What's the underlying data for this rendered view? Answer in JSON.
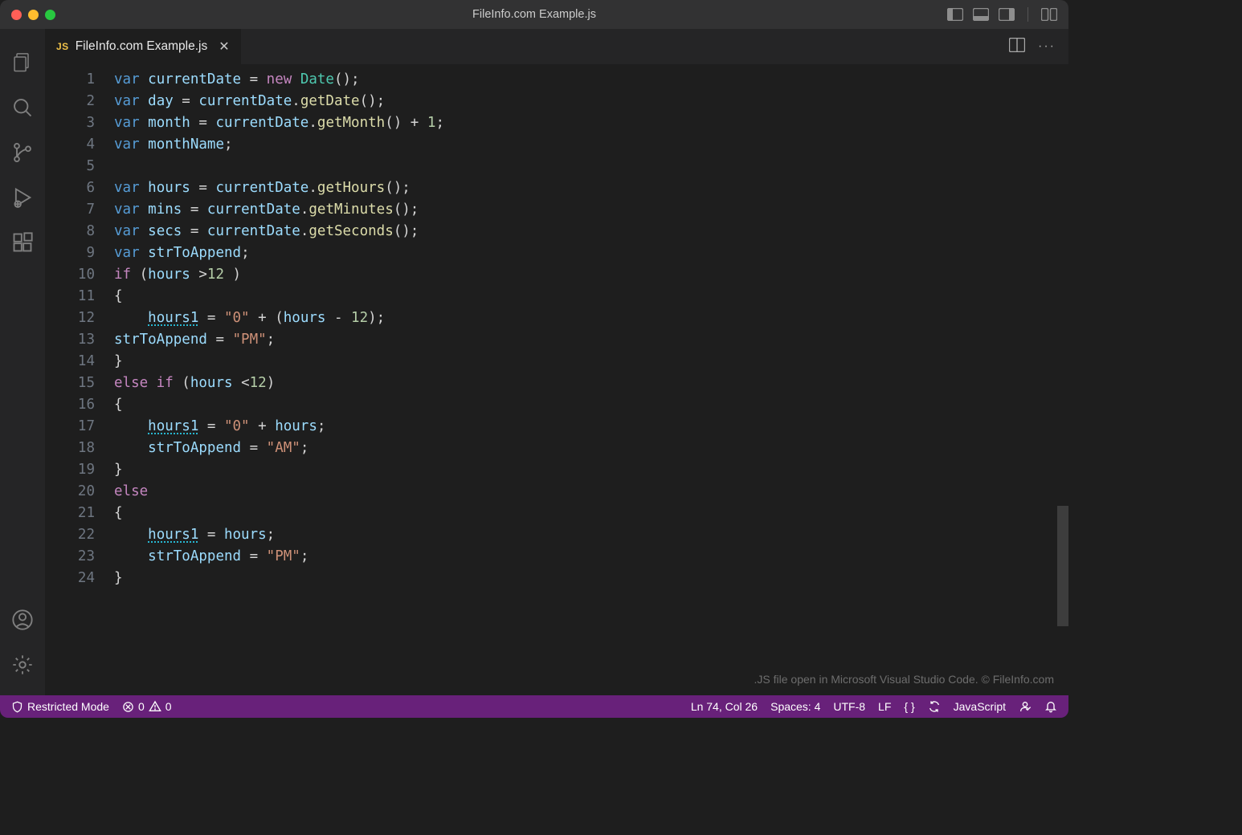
{
  "window": {
    "title": "FileInfo.com Example.js"
  },
  "tab": {
    "badge": "JS",
    "filename": "FileInfo.com Example.js"
  },
  "editor": {
    "watermark": ".JS file open in Microsoft Visual Studio Code. © FileInfo.com",
    "lineNumbers": [
      "1",
      "2",
      "3",
      "4",
      "5",
      "6",
      "7",
      "8",
      "9",
      "10",
      "11",
      "12",
      "13",
      "14",
      "15",
      "16",
      "17",
      "18",
      "19",
      "20",
      "21",
      "22",
      "23",
      "24"
    ],
    "lines": [
      [
        {
          "t": "var ",
          "c": "kw"
        },
        {
          "t": "currentDate",
          "c": "id"
        },
        {
          "t": " = ",
          "c": "op"
        },
        {
          "t": "new ",
          "c": "ctrl"
        },
        {
          "t": "Date",
          "c": "cls"
        },
        {
          "t": "();",
          "c": "op"
        }
      ],
      [
        {
          "t": "var ",
          "c": "kw"
        },
        {
          "t": "day",
          "c": "id"
        },
        {
          "t": " = ",
          "c": "op"
        },
        {
          "t": "currentDate",
          "c": "id"
        },
        {
          "t": ".",
          "c": "op"
        },
        {
          "t": "getDate",
          "c": "fn"
        },
        {
          "t": "();",
          "c": "op"
        }
      ],
      [
        {
          "t": "var ",
          "c": "kw"
        },
        {
          "t": "month",
          "c": "id"
        },
        {
          "t": " = ",
          "c": "op"
        },
        {
          "t": "currentDate",
          "c": "id"
        },
        {
          "t": ".",
          "c": "op"
        },
        {
          "t": "getMonth",
          "c": "fn"
        },
        {
          "t": "() + ",
          "c": "op"
        },
        {
          "t": "1",
          "c": "num"
        },
        {
          "t": ";",
          "c": "op"
        }
      ],
      [
        {
          "t": "var ",
          "c": "kw"
        },
        {
          "t": "monthName",
          "c": "id"
        },
        {
          "t": ";",
          "c": "op"
        }
      ],
      [
        {
          "t": "",
          "c": "op"
        }
      ],
      [
        {
          "t": "var ",
          "c": "kw"
        },
        {
          "t": "hours",
          "c": "id"
        },
        {
          "t": " = ",
          "c": "op"
        },
        {
          "t": "currentDate",
          "c": "id"
        },
        {
          "t": ".",
          "c": "op"
        },
        {
          "t": "getHours",
          "c": "fn"
        },
        {
          "t": "();",
          "c": "op"
        }
      ],
      [
        {
          "t": "var ",
          "c": "kw"
        },
        {
          "t": "mins",
          "c": "id"
        },
        {
          "t": " = ",
          "c": "op"
        },
        {
          "t": "currentDate",
          "c": "id"
        },
        {
          "t": ".",
          "c": "op"
        },
        {
          "t": "getMinutes",
          "c": "fn"
        },
        {
          "t": "();",
          "c": "op"
        }
      ],
      [
        {
          "t": "var ",
          "c": "kw"
        },
        {
          "t": "secs",
          "c": "id"
        },
        {
          "t": " = ",
          "c": "op"
        },
        {
          "t": "currentDate",
          "c": "id"
        },
        {
          "t": ".",
          "c": "op"
        },
        {
          "t": "getSeconds",
          "c": "fn"
        },
        {
          "t": "();",
          "c": "op"
        }
      ],
      [
        {
          "t": "var ",
          "c": "kw"
        },
        {
          "t": "strToAppend",
          "c": "id"
        },
        {
          "t": ";",
          "c": "op"
        }
      ],
      [
        {
          "t": "if ",
          "c": "ctrl"
        },
        {
          "t": "(",
          "c": "op"
        },
        {
          "t": "hours",
          "c": "id"
        },
        {
          "t": " >",
          "c": "op"
        },
        {
          "t": "12",
          "c": "num"
        },
        {
          "t": " )",
          "c": "op"
        }
      ],
      [
        {
          "t": "{",
          "c": "op"
        }
      ],
      [
        {
          "t": "    ",
          "c": "op"
        },
        {
          "t": "hours1",
          "c": "id warn"
        },
        {
          "t": " = ",
          "c": "op"
        },
        {
          "t": "\"0\"",
          "c": "str"
        },
        {
          "t": " + (",
          "c": "op"
        },
        {
          "t": "hours",
          "c": "id"
        },
        {
          "t": " - ",
          "c": "op"
        },
        {
          "t": "12",
          "c": "num"
        },
        {
          "t": ");",
          "c": "op"
        }
      ],
      [
        {
          "t": "strToAppend",
          "c": "id"
        },
        {
          "t": " = ",
          "c": "op"
        },
        {
          "t": "\"PM\"",
          "c": "str"
        },
        {
          "t": ";",
          "c": "op"
        }
      ],
      [
        {
          "t": "}",
          "c": "op"
        }
      ],
      [
        {
          "t": "else if ",
          "c": "ctrl"
        },
        {
          "t": "(",
          "c": "op"
        },
        {
          "t": "hours",
          "c": "id"
        },
        {
          "t": " <",
          "c": "op"
        },
        {
          "t": "12",
          "c": "num"
        },
        {
          "t": ")",
          "c": "op"
        }
      ],
      [
        {
          "t": "{",
          "c": "op"
        }
      ],
      [
        {
          "t": "    ",
          "c": "op"
        },
        {
          "t": "hours1",
          "c": "id warn"
        },
        {
          "t": " = ",
          "c": "op"
        },
        {
          "t": "\"0\"",
          "c": "str"
        },
        {
          "t": " + ",
          "c": "op"
        },
        {
          "t": "hours",
          "c": "id"
        },
        {
          "t": ";",
          "c": "op"
        }
      ],
      [
        {
          "t": "    ",
          "c": "op"
        },
        {
          "t": "strToAppend",
          "c": "id"
        },
        {
          "t": " = ",
          "c": "op"
        },
        {
          "t": "\"AM\"",
          "c": "str"
        },
        {
          "t": ";",
          "c": "op"
        }
      ],
      [
        {
          "t": "}",
          "c": "op"
        }
      ],
      [
        {
          "t": "else",
          "c": "ctrl"
        }
      ],
      [
        {
          "t": "{",
          "c": "op"
        }
      ],
      [
        {
          "t": "    ",
          "c": "op"
        },
        {
          "t": "hours1",
          "c": "id warn"
        },
        {
          "t": " = ",
          "c": "op"
        },
        {
          "t": "hours",
          "c": "id"
        },
        {
          "t": ";",
          "c": "op"
        }
      ],
      [
        {
          "t": "    ",
          "c": "op"
        },
        {
          "t": "strToAppend",
          "c": "id"
        },
        {
          "t": " = ",
          "c": "op"
        },
        {
          "t": "\"PM\"",
          "c": "str"
        },
        {
          "t": ";",
          "c": "op"
        }
      ],
      [
        {
          "t": "}",
          "c": "op"
        }
      ]
    ]
  },
  "statusbar": {
    "restricted": "Restricted Mode",
    "errors": "0",
    "warnings": "0",
    "lncol": "Ln 74, Col 26",
    "spaces": "Spaces: 4",
    "encoding": "UTF-8",
    "eol": "LF",
    "braces_label": "{ }",
    "language": "JavaScript"
  }
}
